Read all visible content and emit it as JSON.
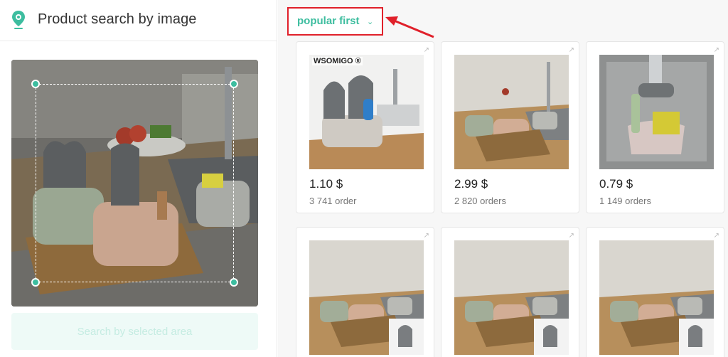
{
  "header": {
    "title": "Product search by image"
  },
  "search": {
    "button_label": "Search by selected area"
  },
  "sort": {
    "label": "popular first"
  },
  "products": [
    {
      "price": "1.10 $",
      "orders": "3 741 order",
      "watermark": "WSOMIGO ®"
    },
    {
      "price": "2.99 $",
      "orders": "2 820 orders"
    },
    {
      "price": "0.79 $",
      "orders": "1 149 orders"
    },
    {
      "price": "",
      "orders": ""
    },
    {
      "price": "",
      "orders": ""
    },
    {
      "price": "",
      "orders": ""
    }
  ],
  "colors": {
    "accent": "#3dbd9f",
    "highlight": "#e0202a"
  },
  "icons": [
    "map-pin-icon",
    "external-link-icon",
    "chevron-down-icon",
    "arrow-icon"
  ]
}
